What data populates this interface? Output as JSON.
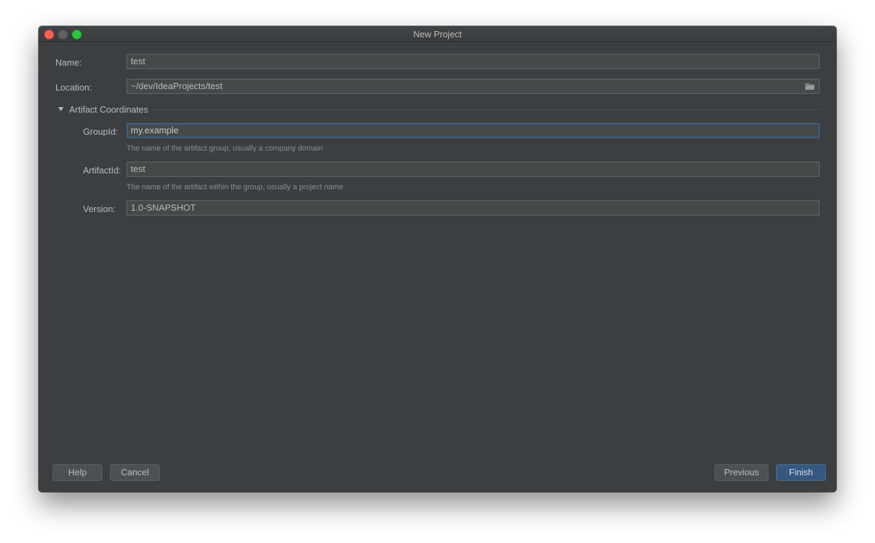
{
  "window": {
    "title": "New Project"
  },
  "form": {
    "name_label": "Name:",
    "name_value": "test",
    "location_label": "Location:",
    "location_value": "~/dev/IdeaProjects/test",
    "section_title": "Artifact Coordinates",
    "groupid_label": "GroupId:",
    "groupid_value": "my.example",
    "groupid_hint": "The name of the artifact group, usually a company domain",
    "artifactid_label": "ArtifactId:",
    "artifactid_value": "test",
    "artifactid_hint": "The name of the artifact within the group, usually a project name",
    "version_label": "Version:",
    "version_value": "1.0-SNAPSHOT"
  },
  "buttons": {
    "help": "Help",
    "cancel": "Cancel",
    "previous": "Previous",
    "finish": "Finish"
  },
  "icons": {
    "close": "close-dot",
    "minimize": "minimize-dot",
    "maximize": "maximize-dot",
    "browse": "folder-icon",
    "expand": "triangle-down-icon"
  },
  "colors": {
    "background": "#3c3f41",
    "field": "#45494a",
    "focus_border": "#3d6185",
    "default_button": "#365880",
    "text": "#bbbbbb",
    "hint": "#8c8c8c"
  }
}
